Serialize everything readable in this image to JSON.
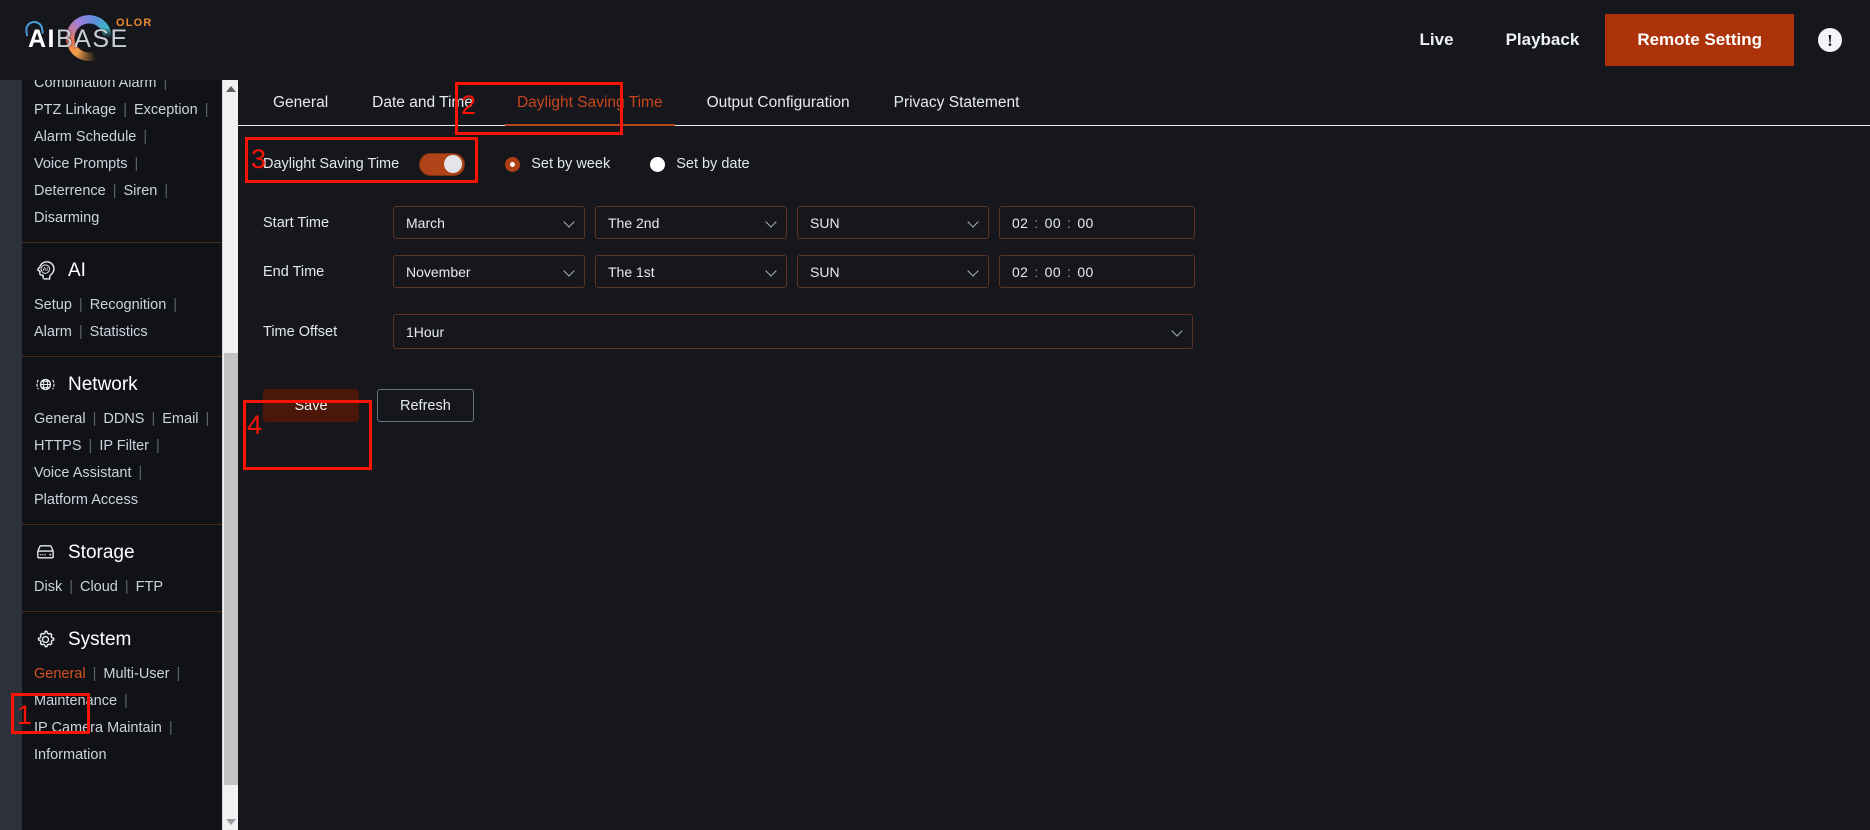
{
  "header": {
    "logo": {
      "ai": "AI",
      "base": "BASE",
      "color_badge": "OLOR"
    },
    "nav": [
      {
        "label": "Live",
        "primary": false
      },
      {
        "label": "Playback",
        "primary": false
      },
      {
        "label": "Remote Setting",
        "primary": true
      }
    ],
    "info_icon_glyph": "!"
  },
  "sidebar": {
    "top_partial": {
      "label": "Combination Alarm",
      "sep": "|"
    },
    "groups": [
      {
        "icon": "",
        "title": "",
        "links": [
          {
            "label": "PTZ Linkage",
            "sep": "|"
          },
          {
            "label": "Exception",
            "sep": "|"
          },
          {
            "label": "Alarm Schedule",
            "sep": "|"
          },
          {
            "label": "Voice Prompts",
            "sep": "|"
          },
          {
            "label": "Deterrence",
            "sep": "|"
          },
          {
            "label": "Siren",
            "sep": "|"
          },
          {
            "label": "Disarming",
            "sep": ""
          }
        ]
      },
      {
        "icon": "ai-head-icon",
        "title": "AI",
        "links": [
          {
            "label": "Setup",
            "sep": "|"
          },
          {
            "label": "Recognition",
            "sep": "|"
          },
          {
            "label": "Alarm",
            "sep": "|"
          },
          {
            "label": "Statistics",
            "sep": ""
          }
        ]
      },
      {
        "icon": "network-globe-icon",
        "title": "Network",
        "links": [
          {
            "label": "General",
            "sep": "|"
          },
          {
            "label": "DDNS",
            "sep": "|"
          },
          {
            "label": "Email",
            "sep": "|"
          },
          {
            "label": "HTTPS",
            "sep": "|"
          },
          {
            "label": "IP Filter",
            "sep": "|"
          },
          {
            "label": "Voice Assistant",
            "sep": "|"
          },
          {
            "label": "Platform Access",
            "sep": ""
          }
        ]
      },
      {
        "icon": "storage-disk-icon",
        "title": "Storage",
        "links": [
          {
            "label": "Disk",
            "sep": "|"
          },
          {
            "label": "Cloud",
            "sep": "|"
          },
          {
            "label": "FTP",
            "sep": ""
          }
        ]
      },
      {
        "icon": "gear-icon",
        "title": "System",
        "links": [
          {
            "label": "General",
            "sep": "|",
            "active": true
          },
          {
            "label": "Multi-User",
            "sep": "|"
          },
          {
            "label": "Maintenance",
            "sep": "|"
          },
          {
            "label": "IP Camera Maintain",
            "sep": "|"
          },
          {
            "label": "Information",
            "sep": ""
          }
        ]
      }
    ]
  },
  "tabs": [
    {
      "label": "General",
      "active": false
    },
    {
      "label": "Date and Time",
      "active": false
    },
    {
      "label": "Daylight Saving Time",
      "active": true
    },
    {
      "label": "Output Configuration",
      "active": false
    },
    {
      "label": "Privacy Statement",
      "active": false
    }
  ],
  "form": {
    "dst_toggle_label": "Daylight Saving Time",
    "dst_toggle_on": true,
    "mode_options": [
      {
        "label": "Set by week",
        "checked": true
      },
      {
        "label": "Set by date",
        "checked": false
      }
    ],
    "start_time": {
      "label": "Start Time",
      "month": "March",
      "ordinal": "The 2nd",
      "weekday": "SUN",
      "hour": "02",
      "minute": "00",
      "second": "00",
      "colon": ":"
    },
    "end_time": {
      "label": "End Time",
      "month": "November",
      "ordinal": "The 1st",
      "weekday": "SUN",
      "hour": "02",
      "minute": "00",
      "second": "00",
      "colon": ":"
    },
    "time_offset": {
      "label": "Time Offset",
      "value": "1Hour"
    },
    "buttons": {
      "save": "Save",
      "refresh": "Refresh"
    }
  },
  "annotations": [
    {
      "number": "1",
      "target": "sidebar-system-general"
    },
    {
      "number": "2",
      "target": "tab-daylight-saving-time"
    },
    {
      "number": "3",
      "target": "dst-toggle"
    },
    {
      "number": "4",
      "target": "save-button"
    }
  ],
  "colors": {
    "accent_orange": "#ac3309",
    "active_link": "#d4521f",
    "annotation_red": "#fb1406",
    "save_button": "#4a1708",
    "page_bg": "#15171c",
    "sidebar_bg": "#101217"
  }
}
